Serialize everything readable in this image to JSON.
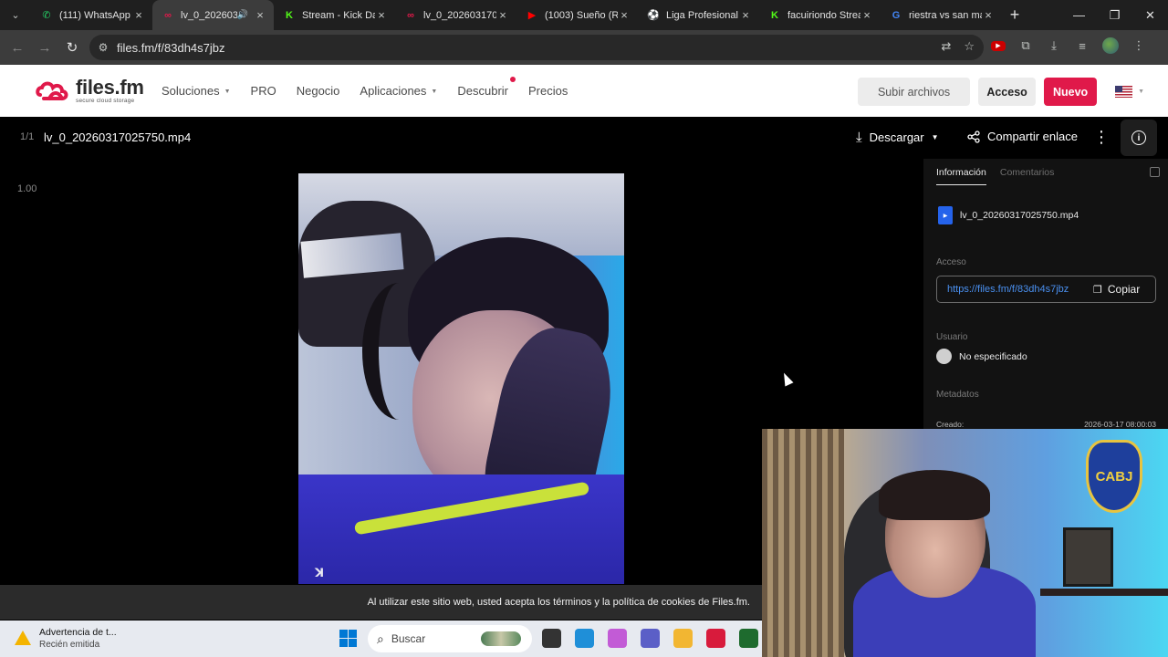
{
  "browser": {
    "tabs": [
      {
        "title": "(111) WhatsApp",
        "icon": "whatsapp-icon",
        "color": "#25d366",
        "glyph": "✆"
      },
      {
        "title": "lv_0_202603",
        "icon": "filesfm-icon",
        "color": "#e0194a",
        "glyph": "∞",
        "audio": true
      },
      {
        "title": "Stream - Kick Da",
        "icon": "kick-icon",
        "color": "#53fc18",
        "glyph": "K"
      },
      {
        "title": "lv_0_20260317025",
        "icon": "filesfm-icon",
        "color": "#e0194a",
        "glyph": "∞"
      },
      {
        "title": "(1003) Sueño (Re",
        "icon": "youtube-icon",
        "color": "#ff0000",
        "glyph": "▶"
      },
      {
        "title": "Liga Profesional",
        "icon": "soccer-ball-icon",
        "color": "#2e8b57",
        "glyph": "⚽"
      },
      {
        "title": "facuiriondo Strea",
        "icon": "kick-icon",
        "color": "#53fc18",
        "glyph": "K"
      },
      {
        "title": "riestra vs san ma",
        "icon": "google-icon",
        "color": "#4285f4",
        "glyph": "G"
      }
    ],
    "url": "files.fm/f/83dh4s7jbz"
  },
  "site": {
    "logo_text": "files.fm",
    "logo_tagline": "secure cloud storage",
    "nav": [
      {
        "label": "Soluciones",
        "has_caret": true
      },
      {
        "label": "PRO",
        "has_caret": false
      },
      {
        "label": "Negocio",
        "has_caret": false
      },
      {
        "label": "Aplicaciones",
        "has_caret": true
      },
      {
        "label": "Descubrir",
        "has_caret": false,
        "has_dot": true
      },
      {
        "label": "Precios",
        "has_caret": false
      }
    ],
    "upload_label": "Subir archivos",
    "login_label": "Acceso",
    "new_label": "Nuevo"
  },
  "viewer": {
    "counter": "1/1",
    "filename": "lv_0_20260317025750.mp4",
    "download_label": "Descargar",
    "share_label": "Compartir enlace",
    "zoom_level": "1.00",
    "video_watermark": "ꓘ"
  },
  "info_panel": {
    "tab_info": "Información",
    "tab_comments": "Comentarios",
    "filename": "lv_0_20260317025750.mp4",
    "access_label": "Acceso",
    "link": "https://files.fm/f/83dh4s7jbz",
    "copy_label": "Copiar",
    "user_label": "Usuario",
    "user_value": "No especificado",
    "metadata_label": "Metadatos",
    "created_label": "Creado:",
    "created_value": "2026-03-17 08:00:03"
  },
  "webcam": {
    "crest_text": "CABJ"
  },
  "cookie_notice": "Al utilizar este sitio web, usted acepta los términos y la política de cookies de Files.fm.",
  "taskbar": {
    "notification_title": "Advertencia de t...",
    "notification_subtitle": "Recién emitida",
    "search_placeholder": "Buscar",
    "icons": [
      {
        "name": "task-view-icon",
        "color": "#333333"
      },
      {
        "name": "edge-icon",
        "color": "#1f8fd8"
      },
      {
        "name": "copilot-icon",
        "color": "#c25bd6"
      },
      {
        "name": "teams-icon",
        "color": "#5b5fc7"
      },
      {
        "name": "file-explorer-icon",
        "color": "#f2b632"
      },
      {
        "name": "news-icon",
        "color": "#d81b3c"
      },
      {
        "name": "app-icon",
        "color": "#1e6b2e"
      }
    ]
  },
  "colors": {
    "brand": "#e0194a",
    "link": "#4a90f0"
  }
}
